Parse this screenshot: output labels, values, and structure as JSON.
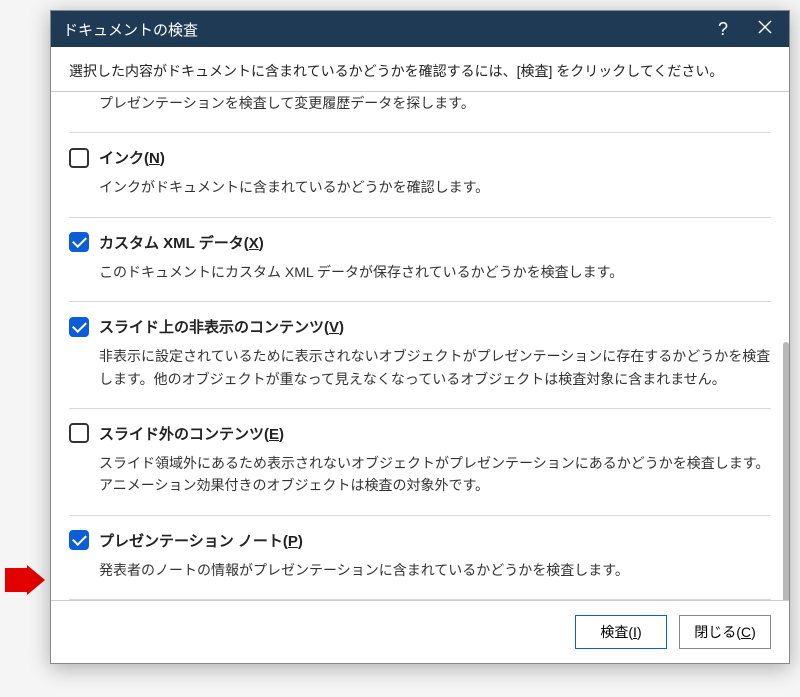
{
  "dialog": {
    "title": "ドキュメントの検査",
    "instruction": "選択した内容がドキュメントに含まれているかどうかを確認するには、[検査] をクリックしてください。",
    "help_label": "?",
    "partial_desc": "プレゼンテーションを検査して変更履歴データを探します。",
    "items": [
      {
        "checked": false,
        "title_pre": "インク(",
        "accel": "N",
        "title_post": ")",
        "desc": "インクがドキュメントに含まれているかどうかを確認します。"
      },
      {
        "checked": true,
        "title_pre": "カスタム XML データ(",
        "accel": "X",
        "title_post": ")",
        "desc": "このドキュメントにカスタム XML データが保存されているかどうかを検査します。"
      },
      {
        "checked": true,
        "title_pre": "スライド上の非表示のコンテンツ(",
        "accel": "V",
        "title_post": ")",
        "desc": "非表示に設定されているために表示されないオブジェクトがプレゼンテーションに存在するかどうかを検査します。他のオブジェクトが重なって見えなくなっているオブジェクトは検査対象に含まれません。"
      },
      {
        "checked": false,
        "title_pre": "スライド外のコンテンツ(",
        "accel": "E",
        "title_post": ")",
        "desc": "スライド領域外にあるため表示されないオブジェクトがプレゼンテーションにあるかどうかを検査します。アニメーション効果付きのオブジェクトは検査の対象外です。"
      },
      {
        "checked": true,
        "title_pre": "プレゼンテーション ノート(",
        "accel": "P",
        "title_post": ")",
        "desc": "発表者のノートの情報がプレゼンテーションに含まれているかどうかを検査します。"
      }
    ],
    "buttons": {
      "inspect_pre": "検査(",
      "inspect_accel": "I",
      "inspect_post": ")",
      "close_pre": "閉じる(",
      "close_accel": "C",
      "close_post": ")"
    }
  }
}
